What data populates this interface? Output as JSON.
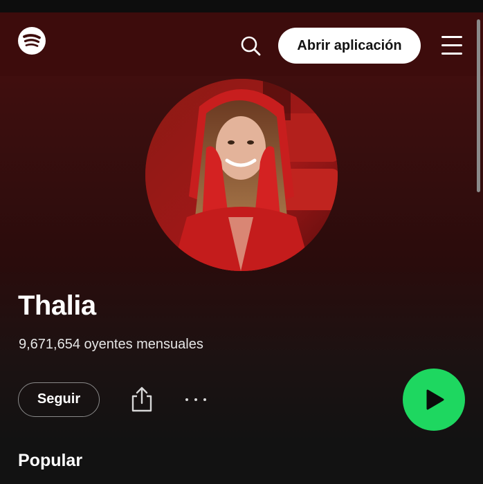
{
  "header": {
    "logo_icon": "spotify-logo-icon",
    "search_icon": "search-icon",
    "open_app_label": "Abrir aplicación",
    "menu_icon": "hamburger-menu-icon"
  },
  "artist": {
    "name": "Thalia",
    "monthly_listeners": "9,671,654 oyentes mensuales",
    "photo": "artist-photo"
  },
  "actions": {
    "follow_label": "Seguir",
    "share_icon": "share-icon",
    "more_icon": "more-options-icon",
    "play_icon": "play-icon"
  },
  "sections": {
    "popular_title": "Popular"
  },
  "colors": {
    "header_bg": "#3d0c0c",
    "gradient_top": "#4a0f0f",
    "page_bg": "#121212",
    "play_green": "#1ed760",
    "button_white": "#ffffff"
  }
}
